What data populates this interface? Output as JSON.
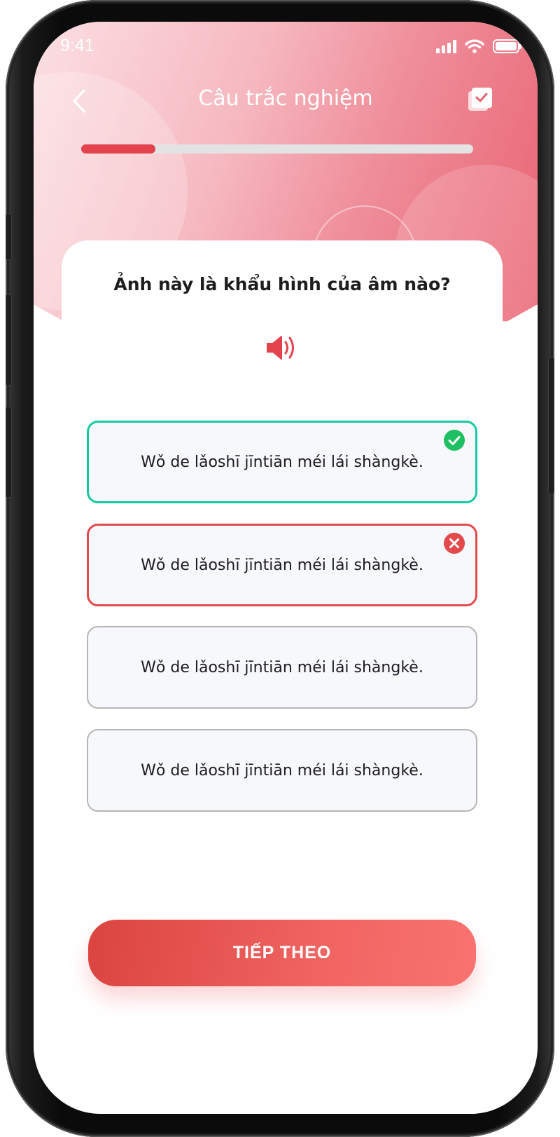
{
  "status_bar": {
    "time": "9:41",
    "icons": [
      "cellular-signal-icon",
      "wifi-icon",
      "battery-icon"
    ]
  },
  "nav": {
    "back_icon": "chevron-left-icon",
    "title": "Câu trắc nghiệm",
    "action_icon": "checklist-icon"
  },
  "progress": {
    "value": 0.19
  },
  "question": {
    "text": "Ảnh này là khẩu hình của âm nào?",
    "audio_icon": "speaker-icon"
  },
  "options": [
    {
      "text": "Wǒ de lǎoshī jīntiān méi lái shàngkè.",
      "state": "correct",
      "badge_icon": "check-circle-icon"
    },
    {
      "text": "Wǒ de lǎoshī jīntiān méi lái shàngkè.",
      "state": "wrong",
      "badge_icon": "x-circle-icon"
    },
    {
      "text": "Wǒ de lǎoshī jīntiān méi lái shàngkè.",
      "state": "default"
    },
    {
      "text": "Wǒ de lǎoshī jīntiān méi lái shàngkè.",
      "state": "default"
    }
  ],
  "next_button": {
    "label": "TIẾP THEO"
  },
  "colors": {
    "accent": "#E2434C",
    "correct": "#17C9A3",
    "wrong": "#E24A4C",
    "header_gradient_start": "#FBE0E4",
    "header_gradient_end": "#E9606F",
    "option_background": "#F7F8FB"
  }
}
